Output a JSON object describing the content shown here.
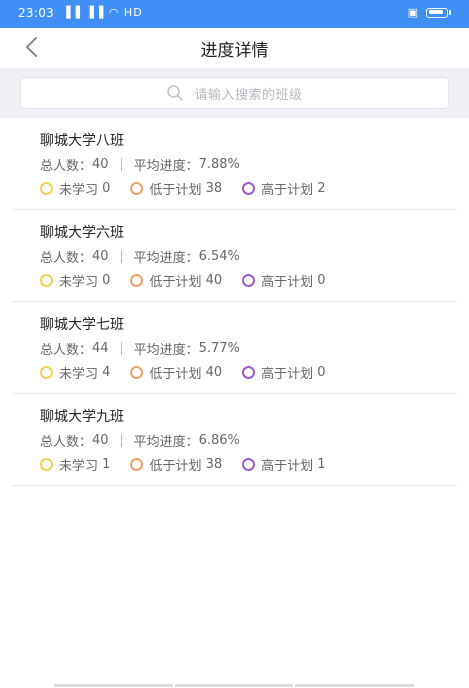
{
  "status_bar": {
    "time": "23:03",
    "signals": "▐▐ ▐▐ ◠ HD",
    "colors": {
      "background": "#3f8ff5"
    }
  },
  "nav": {
    "title": "进度详情"
  },
  "search": {
    "placeholder": "请输入搜索的班级"
  },
  "labels": {
    "total": "总人数：",
    "avg": "平均进度：",
    "not_started": "未学习",
    "below": "低于计划",
    "above": "高于计划"
  },
  "classes": [
    {
      "name": "聊城大学八班",
      "total": "40",
      "avg": "7.88%",
      "not_started": "0",
      "below": "38",
      "above": "2"
    },
    {
      "name": "聊城大学六班",
      "total": "40",
      "avg": "6.54%",
      "not_started": "0",
      "below": "40",
      "above": "0"
    },
    {
      "name": "聊城大学七班",
      "total": "44",
      "avg": "5.77%",
      "not_started": "4",
      "below": "40",
      "above": "0"
    },
    {
      "name": "聊城大学九班",
      "total": "40",
      "avg": "6.86%",
      "not_started": "1",
      "below": "38",
      "above": "1"
    }
  ],
  "colors": {
    "not_started": "#f5d352",
    "below": "#f2a068",
    "above": "#9b59d9"
  }
}
